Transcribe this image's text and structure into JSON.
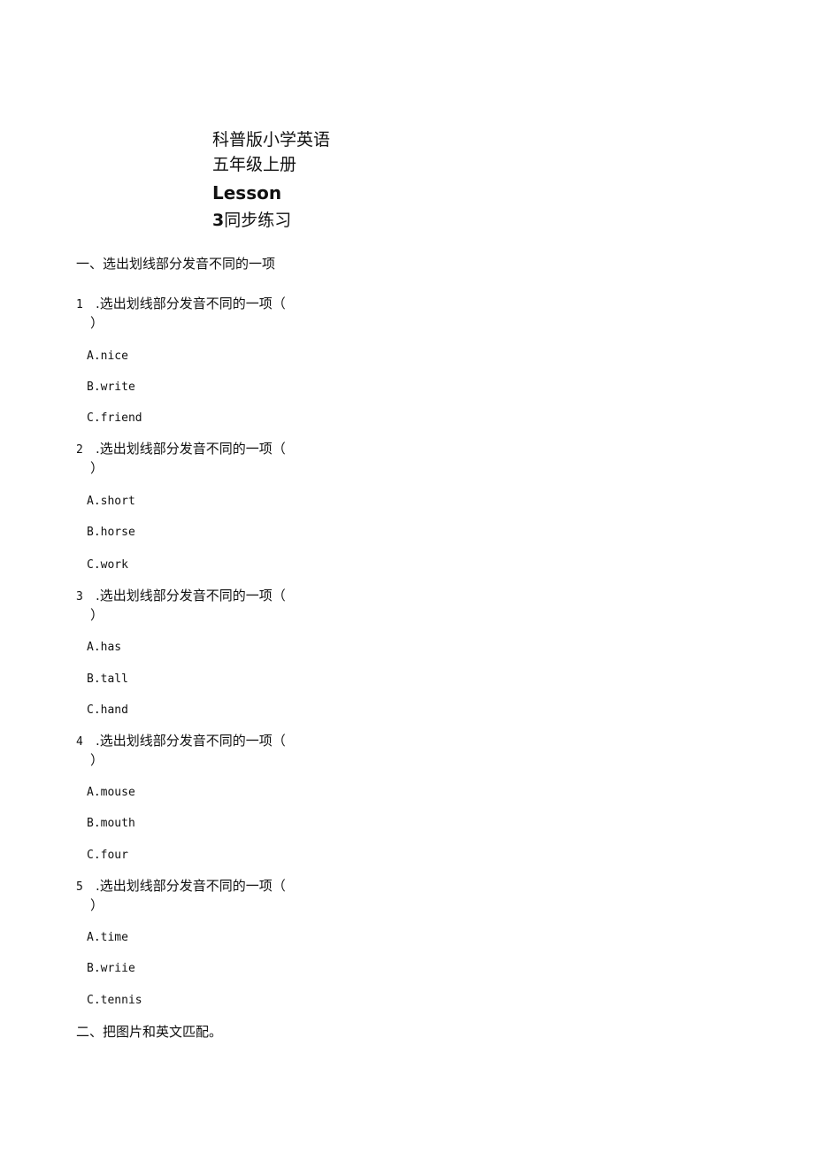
{
  "title": {
    "line1": "科普版小学英语",
    "line2": "五年级上册",
    "line3": "Lesson",
    "line4_num": "3",
    "line4_text": "同步练习"
  },
  "sections": [
    {
      "heading": "一、选出划线部分发音不同的一项",
      "questions": [
        {
          "number": "1",
          "prompt": ".选出划线部分发音不同的一项（",
          "close": "）",
          "options": [
            "A.nice",
            "B.write",
            "C.friend"
          ]
        },
        {
          "number": "2",
          "prompt": ".选出划线部分发音不同的一项（",
          "close": "）",
          "options": [
            "A.short",
            "B.horse",
            "C.work"
          ]
        },
        {
          "number": "3",
          "prompt": ".选出划线部分发音不同的一项（",
          "close": "）",
          "options": [
            "A.has",
            "B.tall",
            "C.hand"
          ]
        },
        {
          "number": "4",
          "prompt": ".选出划线部分发音不同的一项（",
          "close": "）",
          "options": [
            "A.mouse",
            "B.mouth",
            "C.four"
          ]
        },
        {
          "number": "5",
          "prompt": ".选出划线部分发音不同的一项（",
          "close": "）",
          "options": [
            "A.time",
            "B.wriie",
            "C.tennis"
          ]
        }
      ]
    },
    {
      "heading": "二、把图片和英文匹配。"
    }
  ]
}
